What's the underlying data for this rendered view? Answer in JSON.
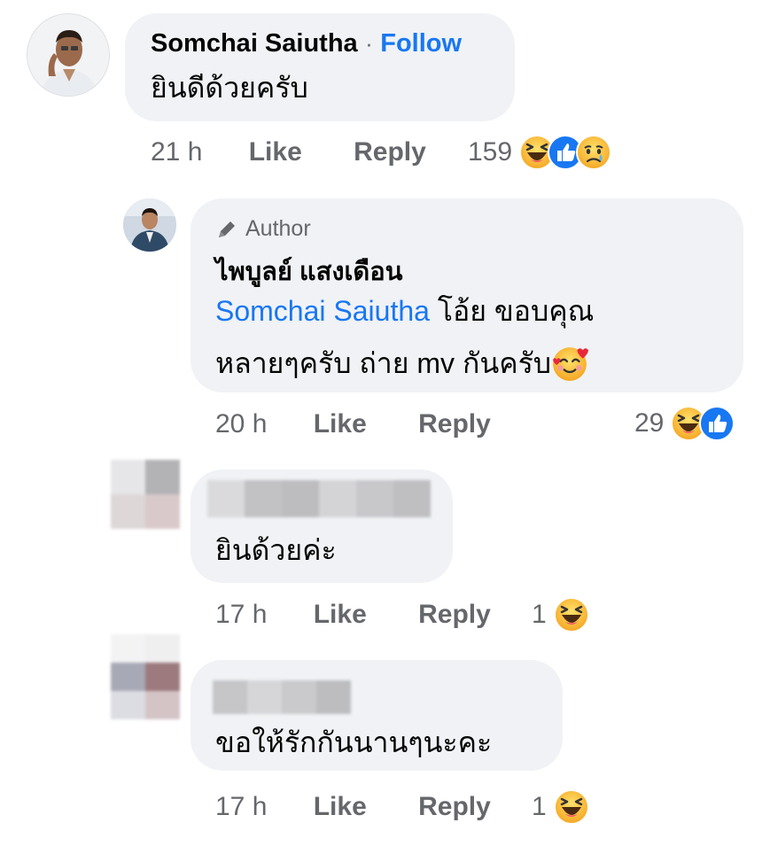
{
  "comments": [
    {
      "name": "Somchai Saiutha",
      "separator": "·",
      "follow_label": "Follow",
      "text": "ยินดีด้วยครับ",
      "time": "21 h",
      "like_label": "Like",
      "reply_label": "Reply",
      "reaction_count": "159",
      "reactions": [
        "haha-icon",
        "like-icon",
        "sad-icon"
      ]
    },
    {
      "badge": "Author",
      "name": "ไพบูลย์ แสงเดือน",
      "mention": "Somchai Saiutha",
      "text_line1_rest": " โอ้ย ขอบคุณ",
      "text_line2": "หลายๆครับ ถ่าย mv กันครับ",
      "time": "20 h",
      "like_label": "Like",
      "reply_label": "Reply",
      "reaction_count": "29",
      "reactions": [
        "haha-icon",
        "like-icon"
      ]
    },
    {
      "text": "ยินด้วยค่ะ",
      "time": "17 h",
      "like_label": "Like",
      "reply_label": "Reply",
      "reaction_count": "1",
      "reactions": [
        "haha-icon"
      ]
    },
    {
      "text": "ขอให้รักกันนานๆนะคะ",
      "time": "17 h",
      "like_label": "Like",
      "reply_label": "Reply",
      "reaction_count": "1",
      "reactions": [
        "haha-icon"
      ]
    }
  ],
  "colors": {
    "bubble": "#f0f2f5",
    "link": "#1877f2",
    "meta": "#65676b",
    "like_blue": "#1877f2",
    "haha_yellow": "#f7b125"
  }
}
